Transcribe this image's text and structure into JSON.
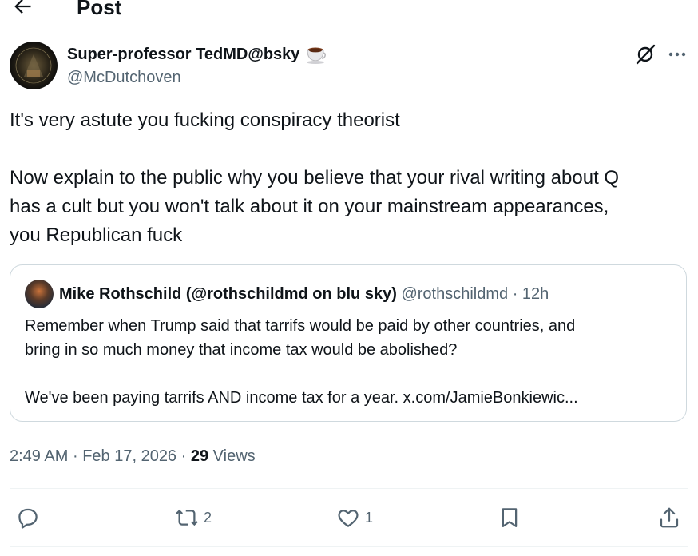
{
  "header": {
    "title": "Post",
    "back_icon": "arrow-left-icon"
  },
  "author": {
    "name": "Super-professor TedMD@bsky",
    "handle": "@McDutchoven",
    "emoji_icon": "teacup-icon"
  },
  "post": {
    "text_lines": [
      "It's very astute you fucking conspiracy theorist",
      "Now explain to the public why you believe that your rival writing about Q",
      "has a cult but you won't talk about it on your mainstream appearances,",
      "you Republican fuck"
    ]
  },
  "quote": {
    "name": "Mike Rothschild (@rothschildmd on blu sky)",
    "handle": "@rothschildmd",
    "separator": "·",
    "time": "12h",
    "lines": [
      "Remember when Trump said that tarrifs would be paid by other countries, and",
      "bring in so much money that income tax would be abolished?",
      "We've been paying tarrifs AND income tax for a year. x.com/JamieBonkiewic..."
    ]
  },
  "meta": {
    "time": "2:49 AM",
    "date": "Feb 17, 2026",
    "sep": "·",
    "views_count": "29",
    "views_label": "Views"
  },
  "actions": {
    "reply_count": "",
    "repost_count": "2",
    "like_count": "1"
  },
  "colors": {
    "text": "#0f1419",
    "secondary": "#536471",
    "border": "#cfd9de",
    "divider": "#eff3f4"
  }
}
